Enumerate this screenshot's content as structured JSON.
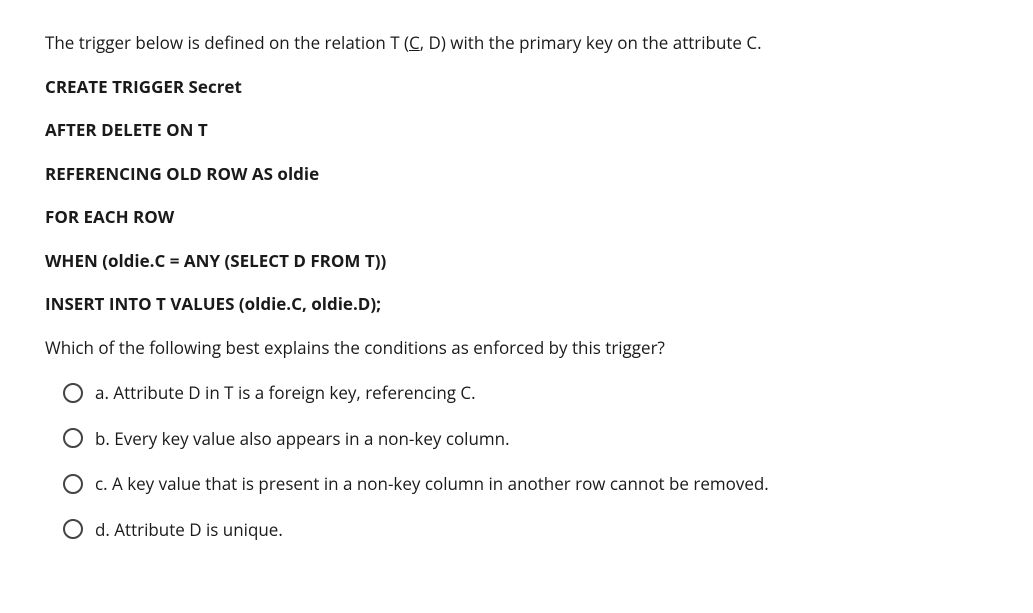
{
  "intro_prefix": "The trigger below is defined on the relation T (",
  "intro_underlined": "C",
  "intro_suffix": ", D) with the primary key on the attribute C.",
  "code": [
    "CREATE TRIGGER Secret",
    "AFTER DELETE ON T",
    "REFERENCING OLD ROW AS oldie",
    "FOR EACH ROW",
    "WHEN (oldie.C = ANY (SELECT D FROM T))",
    "INSERT INTO T VALUES (oldie.C, oldie.D);"
  ],
  "prompt": "Which of the following best explains the conditions as enforced by this trigger?",
  "options": [
    "a. Attribute D in T is a foreign key, referencing C.",
    "b. Every key value also appears in a non-key column.",
    "c. A key value that is present in a non-key column in another row cannot be removed.",
    "d. Attribute D is unique."
  ]
}
